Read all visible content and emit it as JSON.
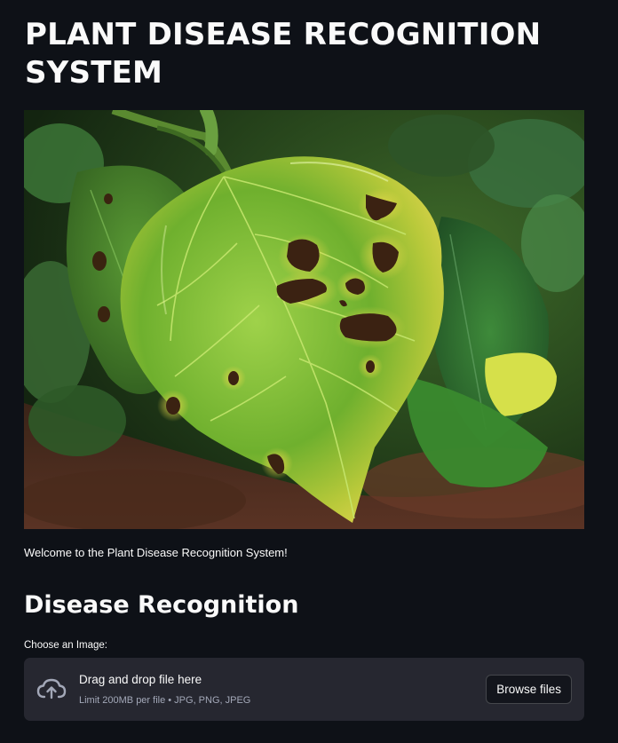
{
  "header": {
    "title": "PLANT DISEASE RECOGNITION SYSTEM"
  },
  "hero_image": {
    "subject": "leaf-with-disease-spots"
  },
  "intro": {
    "welcome_text": "Welcome to the Plant Disease Recognition System!"
  },
  "recognition": {
    "heading": "Disease Recognition",
    "uploader_label": "Choose an Image:",
    "dropzone": {
      "title": "Drag and drop file here",
      "limit_text": "Limit 200MB per file • JPG, PNG, JPEG",
      "browse_label": "Browse files",
      "icon": "cloud-upload-icon"
    }
  },
  "theme": {
    "background": "#0e1117",
    "text": "#fafafa",
    "dropzone_background": "#262730",
    "muted_text": "#a3a8b8"
  }
}
